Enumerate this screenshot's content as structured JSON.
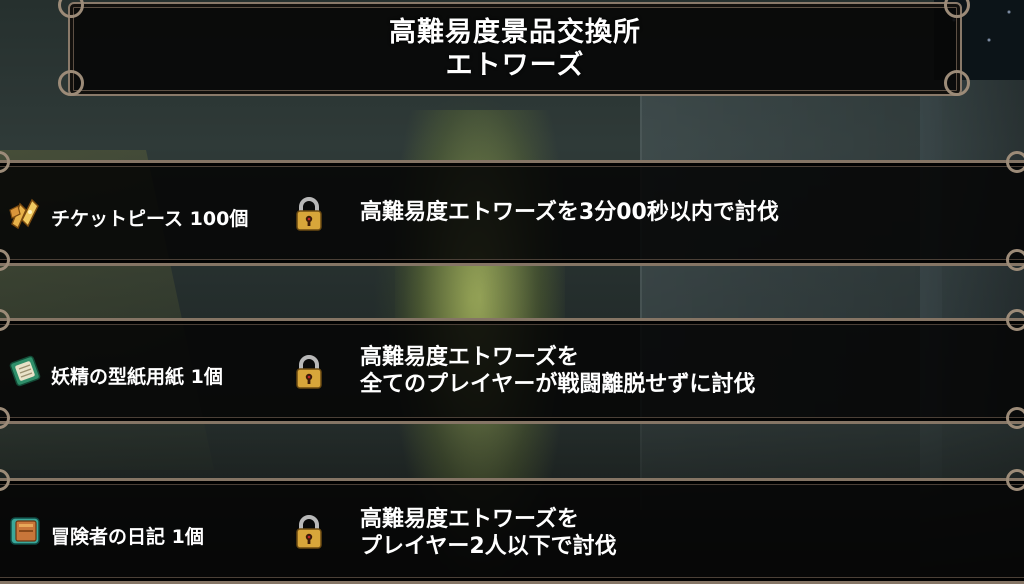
{
  "header": {
    "title_line1": "高難易度景品交換所",
    "title_line2": "エトワーズ"
  },
  "rewards": [
    {
      "icon": "ticket-piece-icon",
      "item": "チケットピース 100個",
      "locked": true,
      "condition_line1": "高難易度エトワーズを3分00秒以内で討伐",
      "condition_line2": ""
    },
    {
      "icon": "fairy-pattern-paper-icon",
      "item": "妖精の型紙用紙 1個",
      "locked": true,
      "condition_line1": "高難易度エトワーズを",
      "condition_line2": "全てのプレイヤーが戦闘離脱せずに討伐"
    },
    {
      "icon": "adventurer-diary-icon",
      "item": "冒険者の日記 1個",
      "locked": true,
      "condition_line1": "高難易度エトワーズを",
      "condition_line2": "プレイヤー2人以下で討伐"
    }
  ],
  "colors": {
    "panel_bg": "#060606",
    "frame": "#857565",
    "text": "#ffffff",
    "lock_gold": "#d8a63a"
  }
}
